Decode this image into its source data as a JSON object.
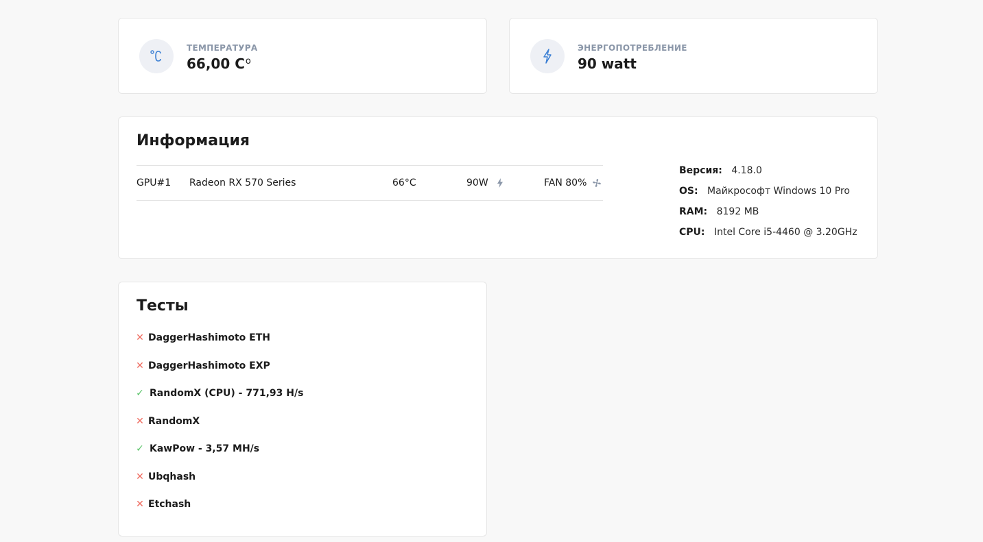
{
  "stats": {
    "temperature": {
      "label": "ТЕМПЕРАТУРА",
      "value": "66,00 C",
      "unit_symbol": "о",
      "icon": "celsius-icon"
    },
    "power": {
      "label": "ЭНЕРГОПОТРЕБЛЕНИЕ",
      "value": "90 watt",
      "icon": "lightning-icon"
    }
  },
  "info": {
    "title": "Информация",
    "gpus": [
      {
        "id": "GPU#1",
        "name": "Radeon RX 570 Series",
        "temp": "66°C",
        "power": "90W",
        "fan": "FAN 80%"
      }
    ],
    "system": [
      {
        "key": "Версия:",
        "value": "4.18.0"
      },
      {
        "key": "OS:",
        "value": "Майкрософт Windows 10 Pro"
      },
      {
        "key": "RAM:",
        "value": "8192 MB"
      },
      {
        "key": "CPU:",
        "value": "Intel Core i5-4460 @ 3.20GHz"
      }
    ]
  },
  "tests": {
    "title": "Тесты",
    "items": [
      {
        "label": "DaggerHashimoto ETH",
        "status": "fail"
      },
      {
        "label": "DaggerHashimoto EXP",
        "status": "fail"
      },
      {
        "label": "RandomX (CPU) - 771,93 H/s",
        "status": "ok"
      },
      {
        "label": "RandomX",
        "status": "fail"
      },
      {
        "label": "KawPow - 3,57 MH/s",
        "status": "ok"
      },
      {
        "label": "Ubqhash",
        "status": "fail"
      },
      {
        "label": "Etchash",
        "status": "fail"
      }
    ]
  },
  "colors": {
    "accent": "#3b7fd4",
    "fail": "#ef6b5f",
    "ok": "#5cc46b",
    "muted": "#8a96a8"
  }
}
